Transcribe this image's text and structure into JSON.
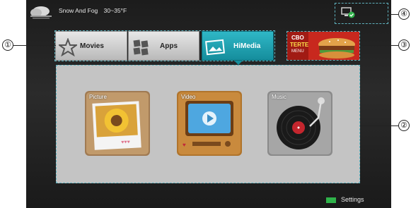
{
  "topbar": {
    "weather_condition": "Snow And Fog",
    "temperature": "30~35°F"
  },
  "tabs": [
    {
      "label": "Movies"
    },
    {
      "label": "Apps"
    },
    {
      "label": "HiMedia"
    }
  ],
  "ad": {
    "line1": "CBO",
    "line2": "TERTE",
    "line3": "MENU"
  },
  "tiles": [
    {
      "label": "Picture"
    },
    {
      "label": "Video"
    },
    {
      "label": "Music"
    }
  ],
  "footer": {
    "settings_label": "Settings"
  },
  "callouts": [
    "①",
    "②",
    "③",
    "④"
  ],
  "colors": {
    "accent": "#1fa3b3",
    "settings_key": "#2fb34a",
    "panel": "#c4c4c4"
  }
}
